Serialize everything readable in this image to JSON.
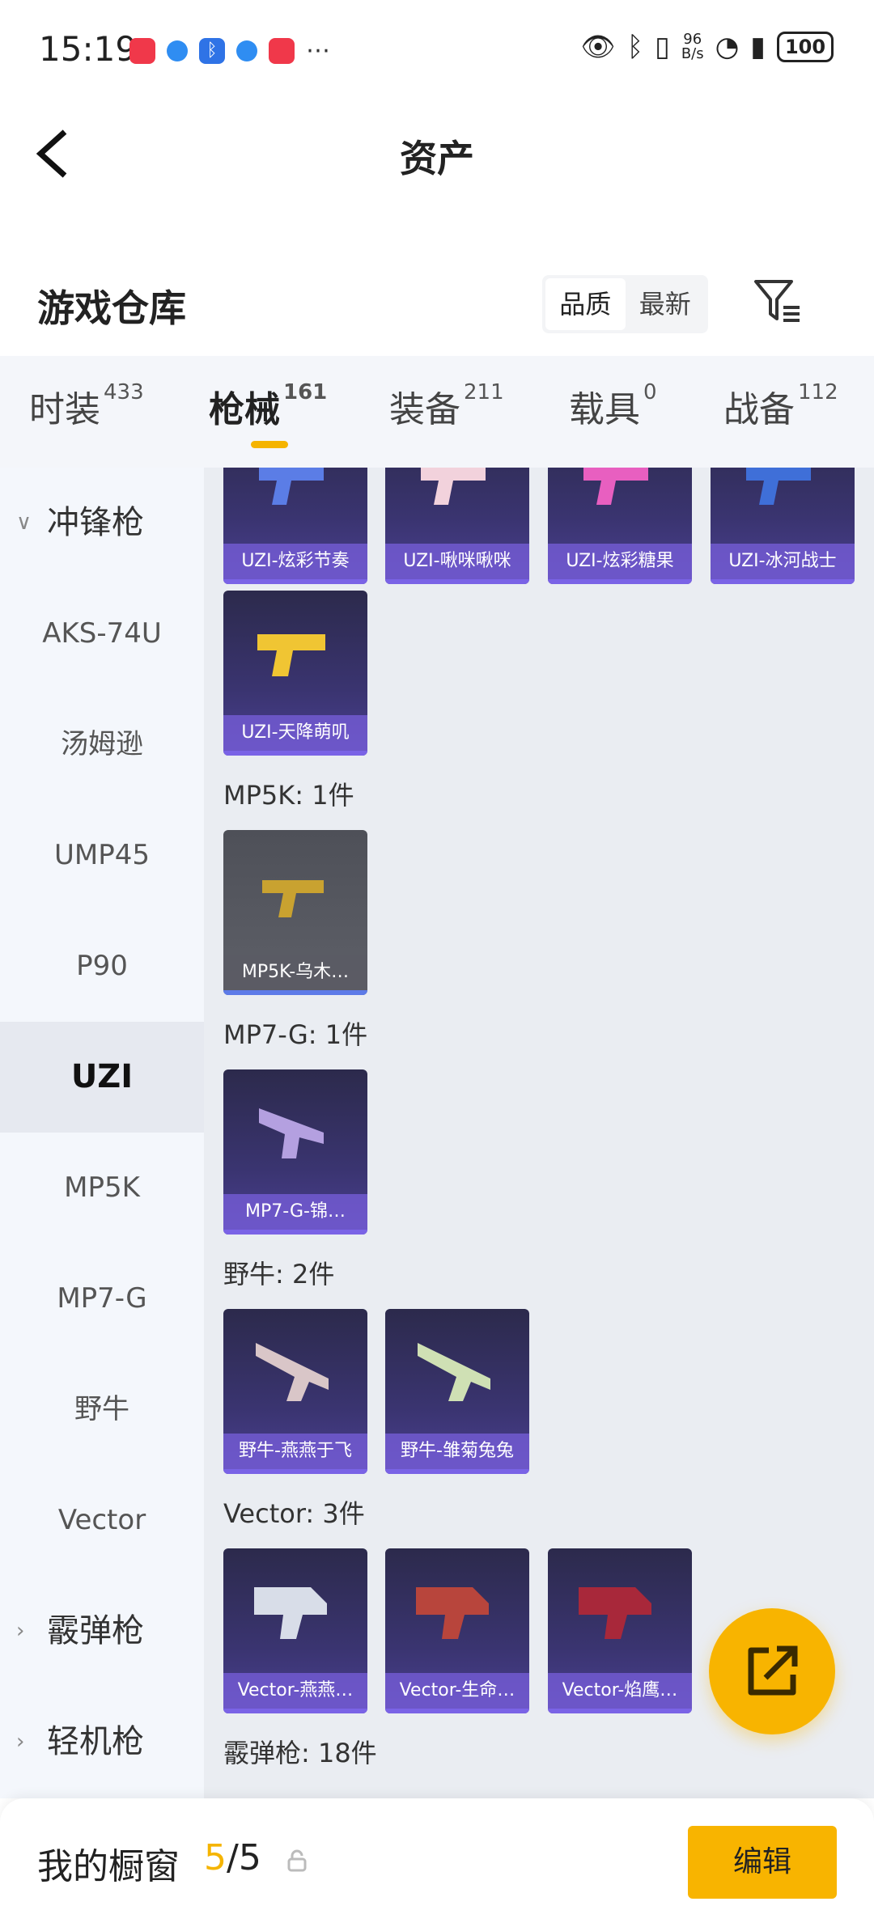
{
  "status_bar": {
    "time": "15:19",
    "net_speed_value": "96",
    "net_speed_unit": "B/s",
    "battery": "100"
  },
  "header": {
    "title": "资产"
  },
  "section": {
    "title": "游戏仓库",
    "sort_options": [
      "品质",
      "最新"
    ],
    "active_sort": "品质"
  },
  "tabs": [
    {
      "label": "时装",
      "count": "433"
    },
    {
      "label": "枪械",
      "count": "161"
    },
    {
      "label": "装备",
      "count": "211"
    },
    {
      "label": "载具",
      "count": "0"
    },
    {
      "label": "战备",
      "count": "112"
    }
  ],
  "active_tab": "枪械",
  "nav": {
    "groups": {
      "smg": "冲锋枪",
      "shotgun": "霰弹枪",
      "lmg": "轻机枪"
    },
    "items": [
      "AKS-74U",
      "汤姆逊",
      "UMP45",
      "P90",
      "UZI",
      "MP5K",
      "MP7-G",
      "野牛",
      "Vector"
    ],
    "active": "UZI"
  },
  "content": {
    "uzi_row1": [
      "UZI-炫彩节奏",
      "UZI-啾咪啾咪",
      "UZI-炫彩糖果",
      "UZI-冰河战士"
    ],
    "uzi_row2": [
      "UZI-天降萌叽"
    ],
    "mp5k": {
      "title": "MP5K: 1件",
      "items": [
        "MP5K-乌木…"
      ]
    },
    "mp7g": {
      "title": "MP7-G: 1件",
      "items": [
        "MP7-G-锦…"
      ]
    },
    "bison": {
      "title": "野牛: 2件",
      "items": [
        "野牛-燕燕于飞",
        "野牛-雏菊兔兔"
      ]
    },
    "vector": {
      "title": "Vector: 3件",
      "items": [
        "Vector-燕燕…",
        "Vector-生命…",
        "Vector-焰鹰…"
      ]
    },
    "shotgun": {
      "title": "霰弹枪: 18件"
    }
  },
  "bottom_bar": {
    "label": "我的橱窗",
    "count_used": "5",
    "count_total": "/5",
    "edit_label": "编辑"
  },
  "colors": {
    "accent": "#f8b400",
    "card_purple": "#3a3470",
    "nav_bg": "#f4f7fc"
  }
}
